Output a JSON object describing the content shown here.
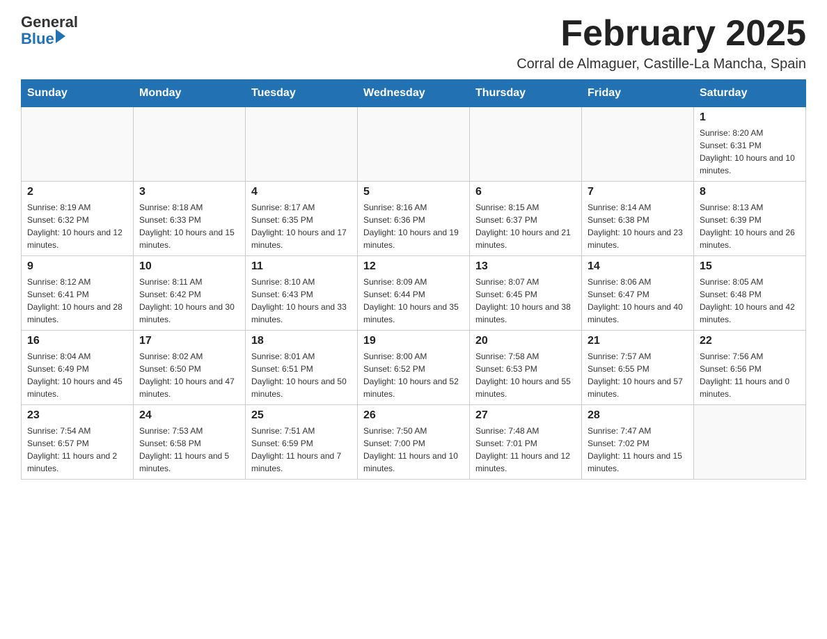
{
  "logo": {
    "text_general": "General",
    "text_blue": "Blue"
  },
  "header": {
    "month_title": "February 2025",
    "subtitle": "Corral de Almaguer, Castille-La Mancha, Spain"
  },
  "weekdays": [
    "Sunday",
    "Monday",
    "Tuesday",
    "Wednesday",
    "Thursday",
    "Friday",
    "Saturday"
  ],
  "weeks": [
    [
      {
        "day": "",
        "info": ""
      },
      {
        "day": "",
        "info": ""
      },
      {
        "day": "",
        "info": ""
      },
      {
        "day": "",
        "info": ""
      },
      {
        "day": "",
        "info": ""
      },
      {
        "day": "",
        "info": ""
      },
      {
        "day": "1",
        "info": "Sunrise: 8:20 AM\nSunset: 6:31 PM\nDaylight: 10 hours and 10 minutes."
      }
    ],
    [
      {
        "day": "2",
        "info": "Sunrise: 8:19 AM\nSunset: 6:32 PM\nDaylight: 10 hours and 12 minutes."
      },
      {
        "day": "3",
        "info": "Sunrise: 8:18 AM\nSunset: 6:33 PM\nDaylight: 10 hours and 15 minutes."
      },
      {
        "day": "4",
        "info": "Sunrise: 8:17 AM\nSunset: 6:35 PM\nDaylight: 10 hours and 17 minutes."
      },
      {
        "day": "5",
        "info": "Sunrise: 8:16 AM\nSunset: 6:36 PM\nDaylight: 10 hours and 19 minutes."
      },
      {
        "day": "6",
        "info": "Sunrise: 8:15 AM\nSunset: 6:37 PM\nDaylight: 10 hours and 21 minutes."
      },
      {
        "day": "7",
        "info": "Sunrise: 8:14 AM\nSunset: 6:38 PM\nDaylight: 10 hours and 23 minutes."
      },
      {
        "day": "8",
        "info": "Sunrise: 8:13 AM\nSunset: 6:39 PM\nDaylight: 10 hours and 26 minutes."
      }
    ],
    [
      {
        "day": "9",
        "info": "Sunrise: 8:12 AM\nSunset: 6:41 PM\nDaylight: 10 hours and 28 minutes."
      },
      {
        "day": "10",
        "info": "Sunrise: 8:11 AM\nSunset: 6:42 PM\nDaylight: 10 hours and 30 minutes."
      },
      {
        "day": "11",
        "info": "Sunrise: 8:10 AM\nSunset: 6:43 PM\nDaylight: 10 hours and 33 minutes."
      },
      {
        "day": "12",
        "info": "Sunrise: 8:09 AM\nSunset: 6:44 PM\nDaylight: 10 hours and 35 minutes."
      },
      {
        "day": "13",
        "info": "Sunrise: 8:07 AM\nSunset: 6:45 PM\nDaylight: 10 hours and 38 minutes."
      },
      {
        "day": "14",
        "info": "Sunrise: 8:06 AM\nSunset: 6:47 PM\nDaylight: 10 hours and 40 minutes."
      },
      {
        "day": "15",
        "info": "Sunrise: 8:05 AM\nSunset: 6:48 PM\nDaylight: 10 hours and 42 minutes."
      }
    ],
    [
      {
        "day": "16",
        "info": "Sunrise: 8:04 AM\nSunset: 6:49 PM\nDaylight: 10 hours and 45 minutes."
      },
      {
        "day": "17",
        "info": "Sunrise: 8:02 AM\nSunset: 6:50 PM\nDaylight: 10 hours and 47 minutes."
      },
      {
        "day": "18",
        "info": "Sunrise: 8:01 AM\nSunset: 6:51 PM\nDaylight: 10 hours and 50 minutes."
      },
      {
        "day": "19",
        "info": "Sunrise: 8:00 AM\nSunset: 6:52 PM\nDaylight: 10 hours and 52 minutes."
      },
      {
        "day": "20",
        "info": "Sunrise: 7:58 AM\nSunset: 6:53 PM\nDaylight: 10 hours and 55 minutes."
      },
      {
        "day": "21",
        "info": "Sunrise: 7:57 AM\nSunset: 6:55 PM\nDaylight: 10 hours and 57 minutes."
      },
      {
        "day": "22",
        "info": "Sunrise: 7:56 AM\nSunset: 6:56 PM\nDaylight: 11 hours and 0 minutes."
      }
    ],
    [
      {
        "day": "23",
        "info": "Sunrise: 7:54 AM\nSunset: 6:57 PM\nDaylight: 11 hours and 2 minutes."
      },
      {
        "day": "24",
        "info": "Sunrise: 7:53 AM\nSunset: 6:58 PM\nDaylight: 11 hours and 5 minutes."
      },
      {
        "day": "25",
        "info": "Sunrise: 7:51 AM\nSunset: 6:59 PM\nDaylight: 11 hours and 7 minutes."
      },
      {
        "day": "26",
        "info": "Sunrise: 7:50 AM\nSunset: 7:00 PM\nDaylight: 11 hours and 10 minutes."
      },
      {
        "day": "27",
        "info": "Sunrise: 7:48 AM\nSunset: 7:01 PM\nDaylight: 11 hours and 12 minutes."
      },
      {
        "day": "28",
        "info": "Sunrise: 7:47 AM\nSunset: 7:02 PM\nDaylight: 11 hours and 15 minutes."
      },
      {
        "day": "",
        "info": ""
      }
    ]
  ]
}
